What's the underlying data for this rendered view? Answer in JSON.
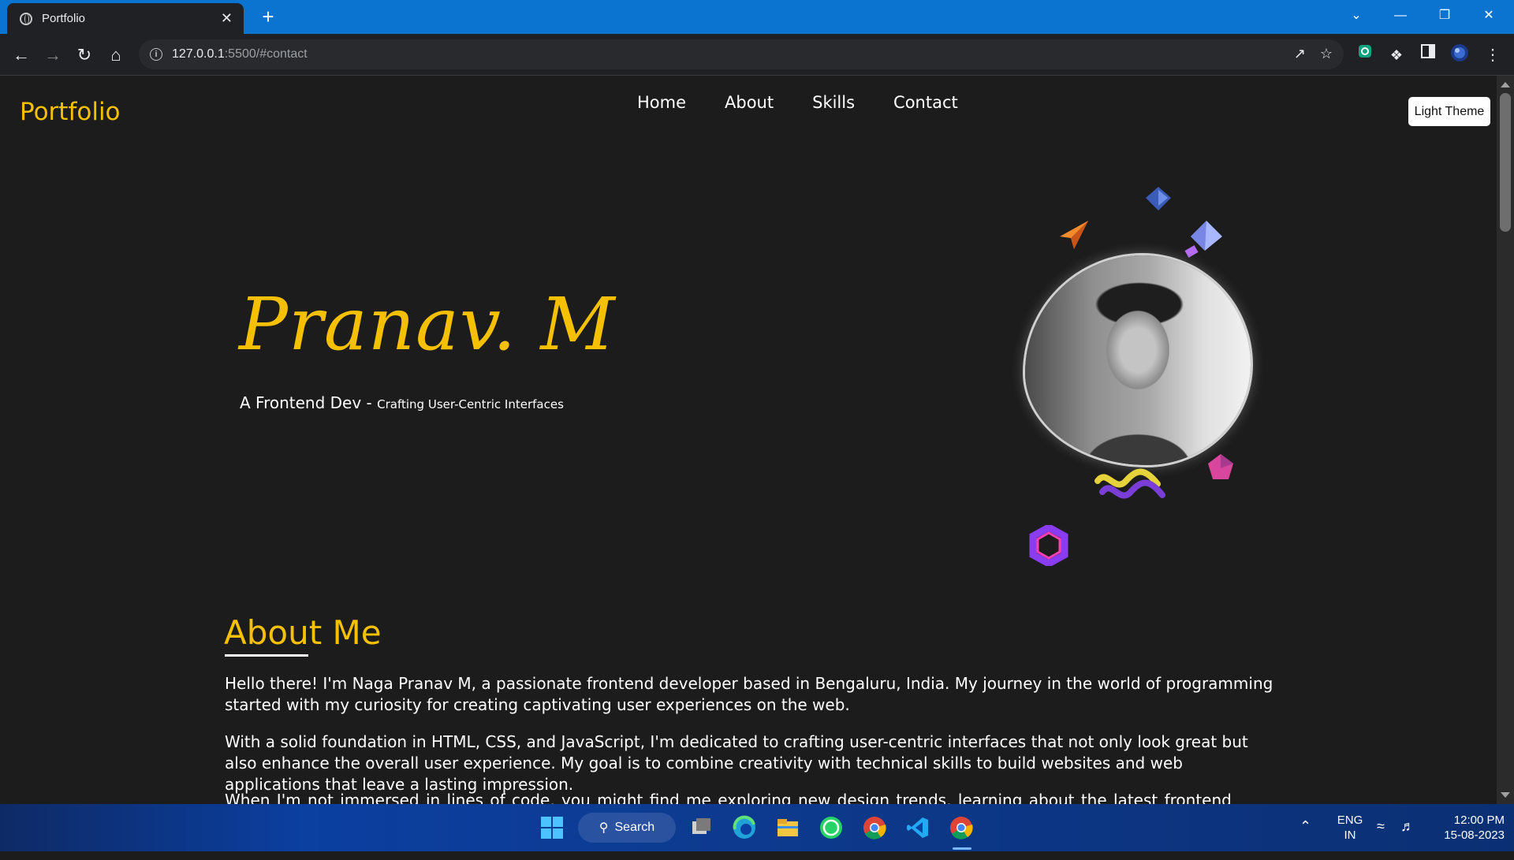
{
  "browser": {
    "tab_title": "Portfolio",
    "url_host": "127.0.0.1",
    "url_rest": ":5500/#contact",
    "new_tab": "+",
    "close_tab": "✕"
  },
  "site": {
    "brand": "Portfolio",
    "nav": [
      "Home",
      "About",
      "Skills",
      "Contact"
    ],
    "theme_button": "Light Theme",
    "accent_color": "#f5c000"
  },
  "hero": {
    "name": "Pranav. M",
    "role": "A Frontend Dev - ",
    "tagline": "Crafting User-Centric Interfaces"
  },
  "about": {
    "title": "About Me",
    "paragraphs": [
      "Hello there! I'm Naga Pranav M, a passionate frontend developer based in Bengaluru, India. My journey in the world of programming started with my curiosity for creating captivating user experiences on the web.",
      "With a solid foundation in HTML, CSS, and JavaScript, I'm dedicated to crafting user-centric interfaces that not only look great but also enhance the overall user experience. My goal is to combine creativity with technical skills to build websites and web applications that leave a lasting impression.",
      "When I'm not immersed in lines of code, you might find me exploring new design trends, learning about the latest frontend technologies, or"
    ]
  },
  "taskbar": {
    "search_label": "Search",
    "language": "ENG",
    "region": "IN",
    "time": "12:00 PM",
    "date": "15-08-2023"
  }
}
